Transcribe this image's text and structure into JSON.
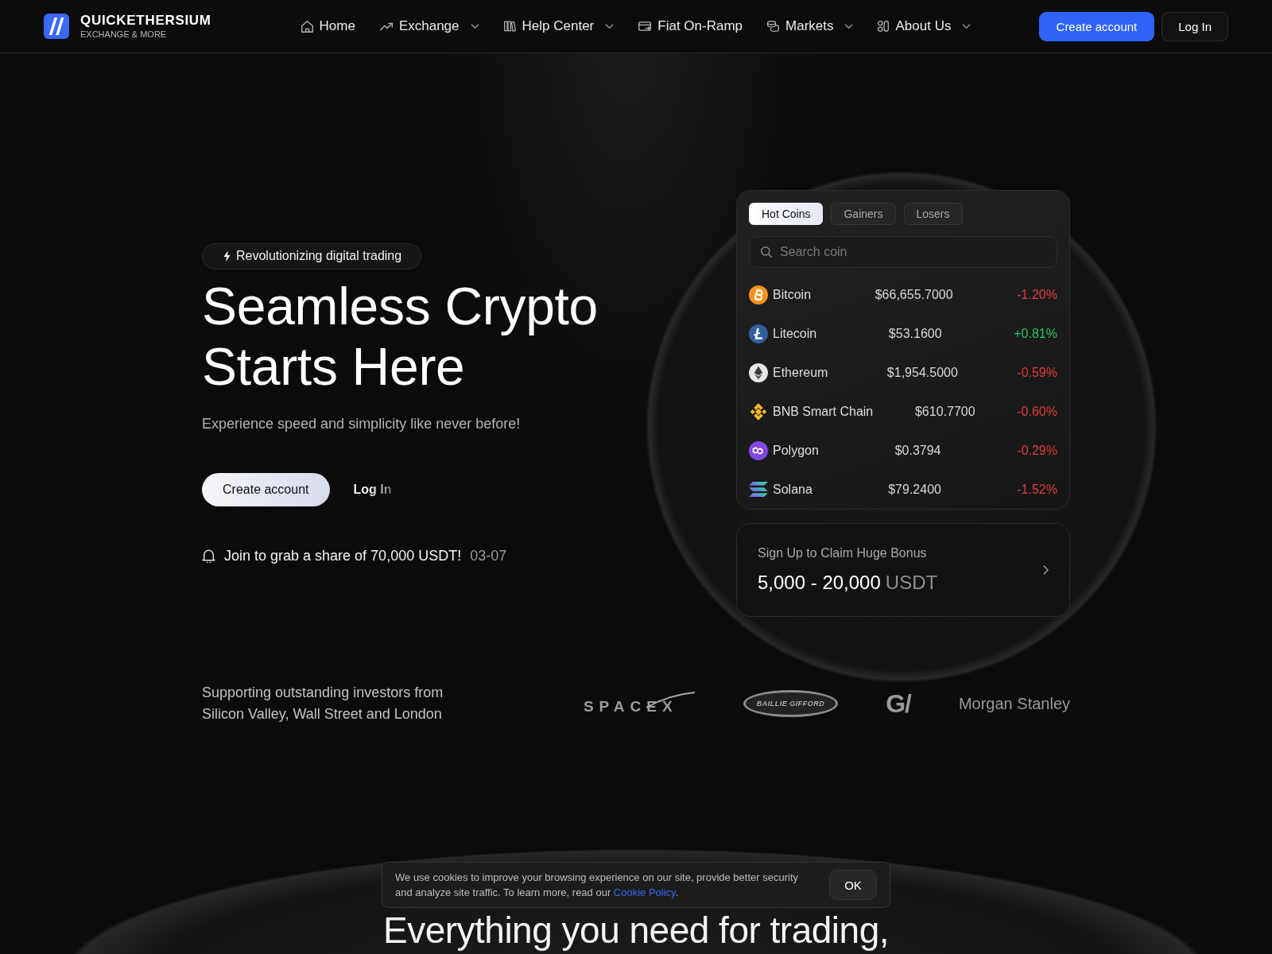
{
  "header": {
    "brand": {
      "name": "QUICKETHERSIUM",
      "tagline": "EXCHANGE & MORE"
    },
    "nav": [
      {
        "label": "Home",
        "kind": "home",
        "dropdown": false
      },
      {
        "label": "Exchange",
        "kind": "trend",
        "dropdown": true
      },
      {
        "label": "Help Center",
        "kind": "books",
        "dropdown": true
      },
      {
        "label": "Fiat On-Ramp",
        "kind": "card",
        "dropdown": false
      },
      {
        "label": "Markets",
        "kind": "coins",
        "dropdown": true
      },
      {
        "label": "About Us",
        "kind": "shapes",
        "dropdown": true
      }
    ],
    "buttons": [
      {
        "label": "Create account",
        "kind": "primary"
      },
      {
        "label": "Log In",
        "kind": "secondary"
      }
    ]
  },
  "hero": {
    "badge": "Revolutionizing digital trading",
    "title": "Seamless Crypto Starts Here",
    "subtitle": "Experience speed and simplicity like never before!",
    "buttons": [
      {
        "label": "Create account",
        "kind": "light"
      },
      {
        "label": "Log In",
        "kind": "ghost"
      }
    ],
    "promo": {
      "text": "Join to grab a share of 70,000 USDT!",
      "date": "03-07"
    }
  },
  "market": {
    "tabs": [
      {
        "label": "Hot Coins",
        "selected": true
      },
      {
        "label": "Gainers",
        "selected": false
      },
      {
        "label": "Losers",
        "selected": false
      }
    ],
    "search": {
      "placeholder": "Search coin"
    },
    "coins": [
      {
        "name": "Bitcoin",
        "kind": "bitcoin",
        "price": "$66,655.7000",
        "change": "-1.20%",
        "rising": false
      },
      {
        "name": "Litecoin",
        "kind": "litecoin",
        "price": "$53.1600",
        "change": "+0.81%",
        "rising": true
      },
      {
        "name": "Ethereum",
        "kind": "ethereum",
        "price": "$1,954.5000",
        "change": "-0.59%",
        "rising": false
      },
      {
        "name": "BNB Smart Chain",
        "kind": "bnb",
        "price": "$610.7700",
        "change": "-0.60%",
        "rising": false
      },
      {
        "name": "Polygon",
        "kind": "polygon",
        "price": "$0.3794",
        "change": "-0.29%",
        "rising": false
      },
      {
        "name": "Solana",
        "kind": "solana",
        "price": "$79.2400",
        "change": "-1.52%",
        "rising": false
      }
    ]
  },
  "bonus": {
    "title": "Sign Up to Claim Huge Bonus",
    "amount": "5,000 - 20,000",
    "unit": "USDT"
  },
  "investors": {
    "text": "Supporting outstanding investors from Silicon Valley, Wall Street and London",
    "logos": [
      {
        "label": "SPACEX",
        "kind": "spacex"
      },
      {
        "label": "BAILLIE GIFFORD",
        "kind": "ring"
      },
      {
        "label": "G/",
        "kind": "mark"
      },
      {
        "label": "Morgan Stanley",
        "kind": "wordmark"
      }
    ]
  },
  "features": {
    "title": "Everything you need for trading,"
  },
  "cookie": {
    "text": "We use cookies to improve your browsing experience on our site, provide better security and analyze site traffic. To learn more, read our",
    "link": "Cookie Policy",
    "end": ".",
    "button": "OK"
  }
}
